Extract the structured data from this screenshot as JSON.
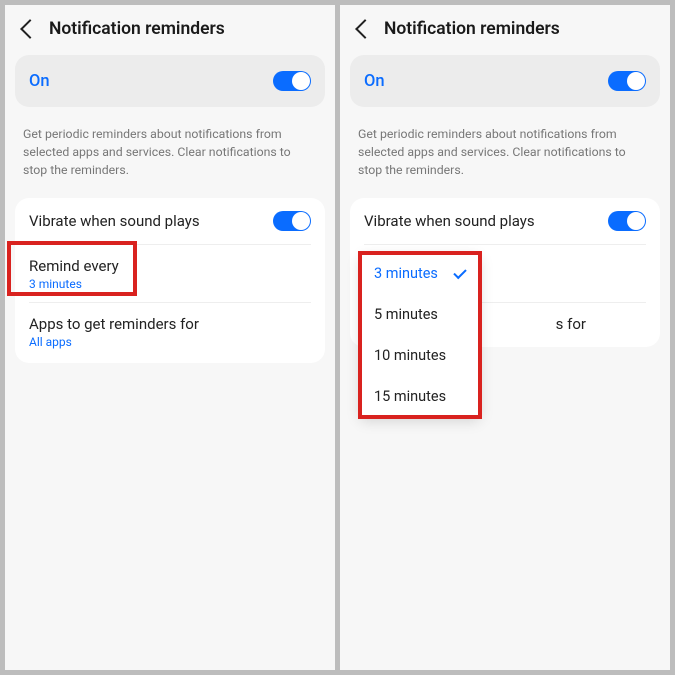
{
  "header": {
    "title": "Notification reminders"
  },
  "main_toggle": {
    "label": "On",
    "state": true
  },
  "description": "Get periodic reminders about notifications from selected apps and services. Clear notifications to stop the reminders.",
  "rows": {
    "vibrate": {
      "label": "Vibrate when sound plays",
      "state": true
    },
    "remind_every": {
      "label": "Remind every",
      "value": "3 minutes"
    },
    "apps": {
      "label": "Apps to get reminders for",
      "value": "All apps"
    }
  },
  "dropdown": {
    "selected": "3 minutes",
    "options": [
      "3 minutes",
      "5 minutes",
      "10 minutes",
      "15 minutes"
    ]
  },
  "right_partial_label": "s for",
  "colors": {
    "accent": "#0a6cff",
    "highlight_box": "#d9221f"
  }
}
